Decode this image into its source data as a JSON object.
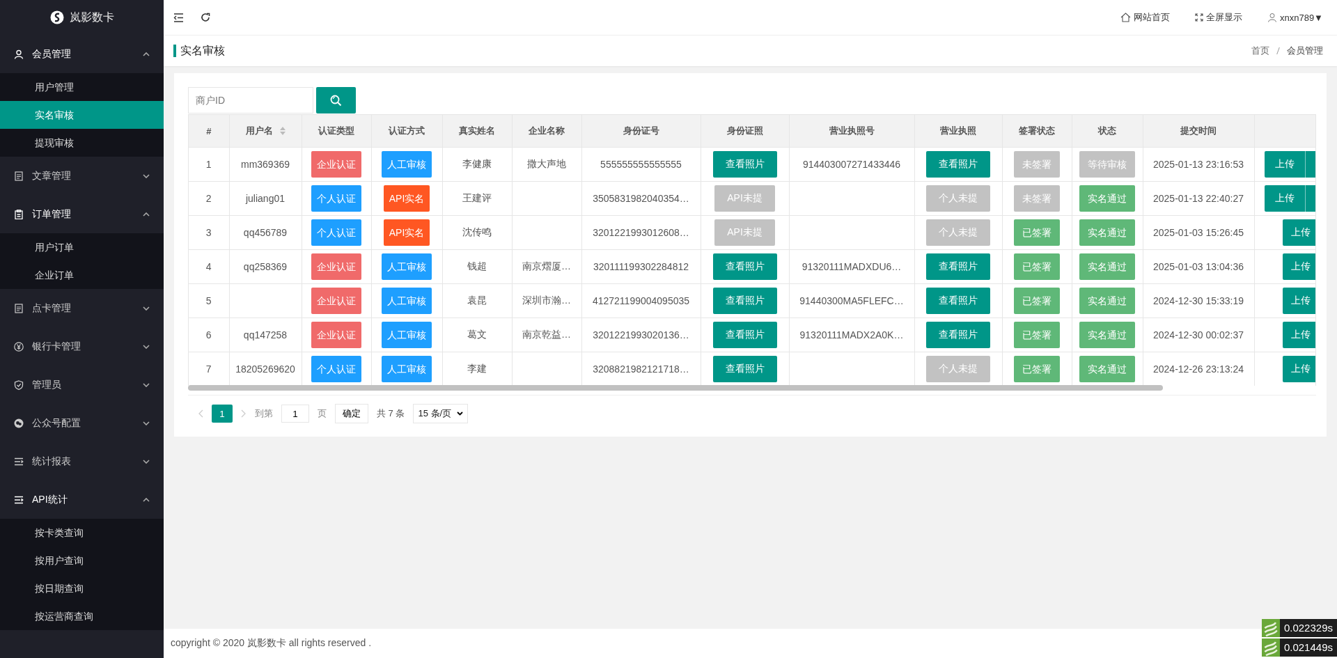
{
  "brand": "岚影数卡",
  "sidebar": [
    {
      "label": "会员管理",
      "expanded": true,
      "children": [
        {
          "label": "用户管理",
          "selected": false
        },
        {
          "label": "实名审核",
          "selected": true
        },
        {
          "label": "提现审核",
          "selected": false
        }
      ]
    },
    {
      "label": "文章管理",
      "expanded": false
    },
    {
      "label": "订单管理",
      "expanded": true,
      "children": [
        {
          "label": "用户订单",
          "selected": false
        },
        {
          "label": "企业订单",
          "selected": false
        }
      ]
    },
    {
      "label": "点卡管理",
      "expanded": false
    },
    {
      "label": "银行卡管理",
      "expanded": false
    },
    {
      "label": "管理员",
      "expanded": false
    },
    {
      "label": "公众号配置",
      "expanded": false
    },
    {
      "label": "统计报表",
      "expanded": false
    },
    {
      "label": "API统计",
      "expanded": true,
      "children": [
        {
          "label": "按卡类查询",
          "selected": false
        },
        {
          "label": "按用户查询",
          "selected": false
        },
        {
          "label": "按日期查询",
          "selected": false
        },
        {
          "label": "按运营商查询",
          "selected": false
        }
      ]
    }
  ],
  "topbar": {
    "links": [
      {
        "label": "网站首页"
      },
      {
        "label": "全屏显示"
      }
    ],
    "user": "xnxn789",
    "caret": "▼"
  },
  "page_title": "实名审核",
  "breadcrumb": [
    "首页",
    "会员管理"
  ],
  "search": {
    "placeholder": "商户ID"
  },
  "table": {
    "columns": [
      "#",
      "用户名",
      "认证类型",
      "认证方式",
      "真实姓名",
      "企业名称",
      "身份证号",
      "身份证照",
      "营业执照号",
      "营业执照",
      "签署状态",
      "状态",
      "提交时间"
    ],
    "rows": [
      {
        "no": "1",
        "username": "mm369369",
        "auth_type": {
          "label": "企业认证",
          "color": "#f06a6a"
        },
        "auth_method": {
          "label": "人工审核",
          "color": "#1e9fff"
        },
        "real_name": "李健康",
        "company": "撒大声地",
        "id_number": "555555555555555",
        "id_photo": {
          "label": "查看照片",
          "color": "#009688"
        },
        "license_no": "914403007271433446",
        "license_photo": {
          "label": "查看照片",
          "color": "#009688"
        },
        "sign_status": {
          "label": "未签署",
          "color": "#c2c2c2"
        },
        "status": {
          "label": "等待审核",
          "color": "#c2c2c2"
        },
        "submitted": "2025-01-13 23:16:53",
        "action": {
          "label": "上传",
          "kind": "group"
        }
      },
      {
        "no": "2",
        "username": "juliang01",
        "auth_type": {
          "label": "个人认证",
          "color": "#1e9fff"
        },
        "auth_method": {
          "label": "API实名",
          "color": "#ff5722"
        },
        "real_name": "王建评",
        "id_number": "3505831982040354…",
        "id_photo": {
          "label": "API未提",
          "color": "#c2c2c2"
        },
        "license_photo": {
          "label": "个人未提",
          "color": "#c2c2c2"
        },
        "sign_status": {
          "label": "未签署",
          "color": "#c2c2c2"
        },
        "status": {
          "label": "实名通过",
          "color": "#5fb878"
        },
        "submitted": "2025-01-13 22:40:27",
        "action": {
          "label": "上传",
          "kind": "group"
        }
      },
      {
        "no": "3",
        "username": "qq456789",
        "auth_type": {
          "label": "个人认证",
          "color": "#1e9fff"
        },
        "auth_method": {
          "label": "API实名",
          "color": "#ff5722"
        },
        "real_name": "沈传鸣",
        "id_number": "3201221993012608…",
        "id_photo": {
          "label": "API未提",
          "color": "#c2c2c2"
        },
        "license_photo": {
          "label": "个人未提",
          "color": "#c2c2c2"
        },
        "sign_status": {
          "label": "已签署",
          "color": "#5fb878"
        },
        "status": {
          "label": "实名通过",
          "color": "#5fb878"
        },
        "submitted": "2025-01-03 15:26:45",
        "action": {
          "label": "上传",
          "kind": "single"
        }
      },
      {
        "no": "4",
        "username": "qq258369",
        "auth_type": {
          "label": "企业认证",
          "color": "#f06a6a"
        },
        "auth_method": {
          "label": "人工审核",
          "color": "#1e9fff"
        },
        "real_name": "钱超",
        "company": "南京熠厦…",
        "id_number": "320111199302284812",
        "id_photo": {
          "label": "查看照片",
          "color": "#009688"
        },
        "license_no": "91320111MADXDU6…",
        "license_photo": {
          "label": "查看照片",
          "color": "#009688"
        },
        "sign_status": {
          "label": "已签署",
          "color": "#5fb878"
        },
        "status": {
          "label": "实名通过",
          "color": "#5fb878"
        },
        "submitted": "2025-01-03 13:04:36",
        "action": {
          "label": "上传",
          "kind": "single"
        }
      },
      {
        "no": "5",
        "auth_type": {
          "label": "企业认证",
          "color": "#f06a6a"
        },
        "auth_method": {
          "label": "人工审核",
          "color": "#1e9fff"
        },
        "real_name": "袁昆",
        "company": "深圳市瀚…",
        "id_number": "412721199004095035",
        "id_photo": {
          "label": "查看照片",
          "color": "#009688"
        },
        "license_no": "91440300MA5FLEFC…",
        "license_photo": {
          "label": "查看照片",
          "color": "#009688"
        },
        "sign_status": {
          "label": "已签署",
          "color": "#5fb878"
        },
        "status": {
          "label": "实名通过",
          "color": "#5fb878"
        },
        "submitted": "2024-12-30 15:33:19",
        "action": {
          "label": "上传",
          "kind": "single"
        }
      },
      {
        "no": "6",
        "username": "qq147258",
        "auth_type": {
          "label": "企业认证",
          "color": "#f06a6a"
        },
        "auth_method": {
          "label": "人工审核",
          "color": "#1e9fff"
        },
        "real_name": "葛文",
        "company": "南京乾益…",
        "id_number": "3201221993020136…",
        "id_photo": {
          "label": "查看照片",
          "color": "#009688"
        },
        "license_no": "91320111MADX2A0K…",
        "license_photo": {
          "label": "查看照片",
          "color": "#009688"
        },
        "sign_status": {
          "label": "已签署",
          "color": "#5fb878"
        },
        "status": {
          "label": "实名通过",
          "color": "#5fb878"
        },
        "submitted": "2024-12-30 00:02:37",
        "action": {
          "label": "上传",
          "kind": "single"
        }
      },
      {
        "no": "7",
        "username": "18205269620",
        "auth_type": {
          "label": "个人认证",
          "color": "#1e9fff"
        },
        "auth_method": {
          "label": "人工审核",
          "color": "#1e9fff"
        },
        "real_name": "李建",
        "id_number": "3208821982121718…",
        "id_photo": {
          "label": "查看照片",
          "color": "#009688"
        },
        "license_photo": {
          "label": "个人未提",
          "color": "#c2c2c2"
        },
        "sign_status": {
          "label": "已签署",
          "color": "#5fb878"
        },
        "status": {
          "label": "实名通过",
          "color": "#5fb878"
        },
        "submitted": "2024-12-26 23:13:24",
        "action": {
          "label": "上传",
          "kind": "single"
        }
      }
    ]
  },
  "pagination": {
    "pages": [
      {
        "label": "1",
        "selected": true
      }
    ],
    "goto_label": "到第",
    "goto_value": "1",
    "page_label": "页",
    "confirm": "确定",
    "total": "共 7 条",
    "page_size": "15 条/页"
  },
  "footer": "copyright © 2020 岚影数卡 all rights reserved .",
  "timings": [
    "0.022329s",
    "0.021449s"
  ]
}
